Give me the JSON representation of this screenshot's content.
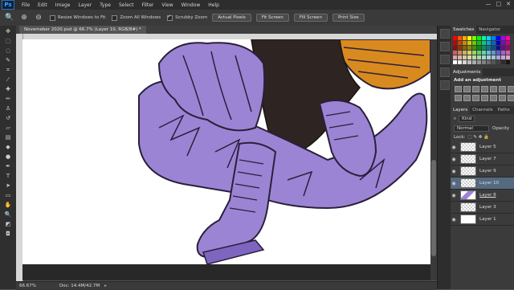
{
  "app": {
    "logo": "Ps"
  },
  "menu": [
    "File",
    "Edit",
    "Image",
    "Layer",
    "Type",
    "Select",
    "Filter",
    "View",
    "Window",
    "Help"
  ],
  "window_controls": [
    "—",
    "□",
    "✕"
  ],
  "options": {
    "resize_windows": "Resize Windows to Fit",
    "zoom_all_windows": "Zoom All Windows",
    "scrubby_zoom": "Scrubby Zoom",
    "actual_pixels": "Actual Pixels",
    "fit_screen": "Fit Screen",
    "fill_screen": "Fill Screen",
    "print_size": "Print Size"
  },
  "document_tab": "Novemeber 2020.psd @ 66.7% (Layer 10, RGB/8#) *",
  "status": {
    "zoom": "66.67%",
    "doc": "Doc: 14.4M/42.7M"
  },
  "panels": {
    "swatches_tab": "Swatches",
    "navigator_tab": "Navigator",
    "adjustments_tab": "Adjustments",
    "adjustments_title": "Add an adjustment",
    "layers_tab": "Layers",
    "channels_tab": "Channels",
    "paths_tab": "Paths",
    "kind_label": "Kind",
    "blend_mode": "Normal",
    "opacity_label": "Opacity",
    "lock_label": "Lock:"
  },
  "layers": [
    {
      "name": "Layer 5"
    },
    {
      "name": "Layer 7"
    },
    {
      "name": "Layer 9"
    },
    {
      "name": "Layer 10"
    },
    {
      "name": "Layer 8"
    },
    {
      "name": "Layer 3"
    },
    {
      "name": "Layer 1"
    }
  ],
  "colors": {
    "purple": "#9b84d4",
    "purple_dark": "#7e65c0",
    "boot_dark": "#2e2422",
    "orange": "#d98a1e",
    "line": "#2a1f3a"
  }
}
